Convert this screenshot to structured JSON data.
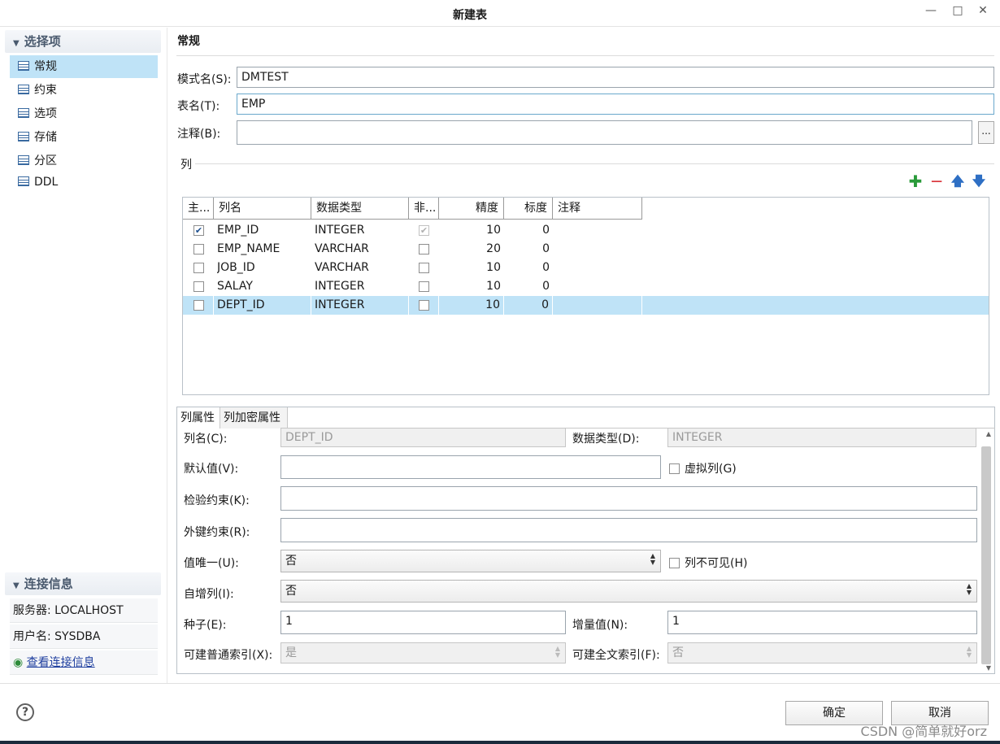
{
  "window": {
    "title": "新建表",
    "minimize_icon": "minimize-icon",
    "maximize_icon": "maximize-icon",
    "close_icon": "close-icon"
  },
  "sidebar": {
    "header": "选择项",
    "items": [
      {
        "label": "常规",
        "selected": true
      },
      {
        "label": "约束",
        "selected": false
      },
      {
        "label": "选项",
        "selected": false
      },
      {
        "label": "存储",
        "selected": false
      },
      {
        "label": "分区",
        "selected": false
      },
      {
        "label": "DDL",
        "selected": false
      }
    ],
    "conn_header": "连接信息",
    "server": "服务器: LOCALHOST",
    "user": "用户名: SYSDBA",
    "view_conn_link": "查看连接信息"
  },
  "general": {
    "section_title": "常规",
    "schema_label": "模式名(S):",
    "schema_value": "DMTEST",
    "table_label": "表名(T):",
    "table_value": "EMP",
    "comment_label": "注释(B):",
    "comment_value": "",
    "comment_button": "..."
  },
  "columns_group": {
    "title": "列",
    "headers": [
      "主...",
      "列名",
      "数据类型",
      "非...",
      "精度",
      "标度",
      "注释"
    ],
    "rows": [
      {
        "pk": true,
        "name": "EMP_ID",
        "type": "INTEGER",
        "notnull": true,
        "notnull_disabled": true,
        "precision": "10",
        "scale": "0",
        "comment": ""
      },
      {
        "pk": false,
        "name": "EMP_NAME",
        "type": "VARCHAR",
        "notnull": false,
        "notnull_disabled": false,
        "precision": "20",
        "scale": "0",
        "comment": ""
      },
      {
        "pk": false,
        "name": "JOB_ID",
        "type": "VARCHAR",
        "notnull": false,
        "notnull_disabled": false,
        "precision": "10",
        "scale": "0",
        "comment": ""
      },
      {
        "pk": false,
        "name": "SALAY",
        "type": "INTEGER",
        "notnull": false,
        "notnull_disabled": false,
        "precision": "10",
        "scale": "0",
        "comment": ""
      },
      {
        "pk": false,
        "name": "DEPT_ID",
        "type": "INTEGER",
        "notnull": false,
        "notnull_disabled": false,
        "precision": "10",
        "scale": "0",
        "comment": "",
        "selected": true
      }
    ],
    "toolbar_icons": [
      "add-icon",
      "remove-icon",
      "move-up-icon",
      "move-down-icon"
    ]
  },
  "properties": {
    "tabs": [
      "列属性",
      "列加密属性"
    ],
    "col_name_label": "列名(C):",
    "col_name_value": "DEPT_ID",
    "data_type_label": "数据类型(D):",
    "data_type_value": "INTEGER",
    "default_label": "默认值(V):",
    "default_value": "",
    "virtual_label": "虚拟列(G)",
    "check_label": "检验约束(K):",
    "check_value": "",
    "fk_label": "外键约束(R):",
    "fk_value": "",
    "unique_label": "值唯一(U):",
    "unique_value": "否",
    "invisible_label": "列不可见(H)",
    "identity_label": "自增列(I):",
    "identity_value": "否",
    "seed_label": "种子(E):",
    "seed_value": "1",
    "increment_label": "增量值(N):",
    "increment_value": "1",
    "normal_index_label": "可建普通索引(X):",
    "normal_index_value": "是",
    "fulltext_index_label": "可建全文索引(F):",
    "fulltext_index_value": "否"
  },
  "footer": {
    "help_icon": "help-icon",
    "ok": "确定",
    "cancel": "取消",
    "watermark": "CSDN @简单就好orz"
  }
}
